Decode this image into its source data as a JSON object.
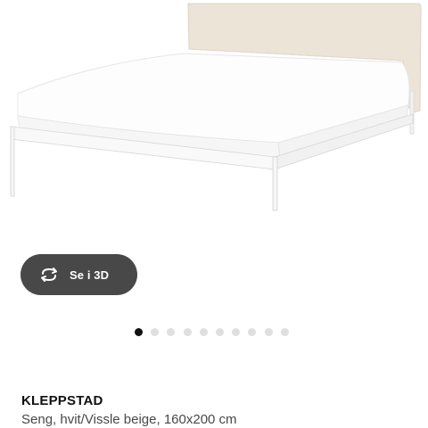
{
  "product": {
    "name": "KLEPPSTAD",
    "description": "Seng, hvit/Vissle beige,",
    "size": "160x200 cm"
  },
  "viewer": {
    "button_label": "Se i 3D",
    "button_icon": "rotate-3d-icon"
  },
  "gallery": {
    "total_images": 10,
    "active_index": 0
  },
  "colors": {
    "button_bg": "#484848",
    "dot_active": "#111111",
    "dot_inactive": "#dfdfdf"
  }
}
